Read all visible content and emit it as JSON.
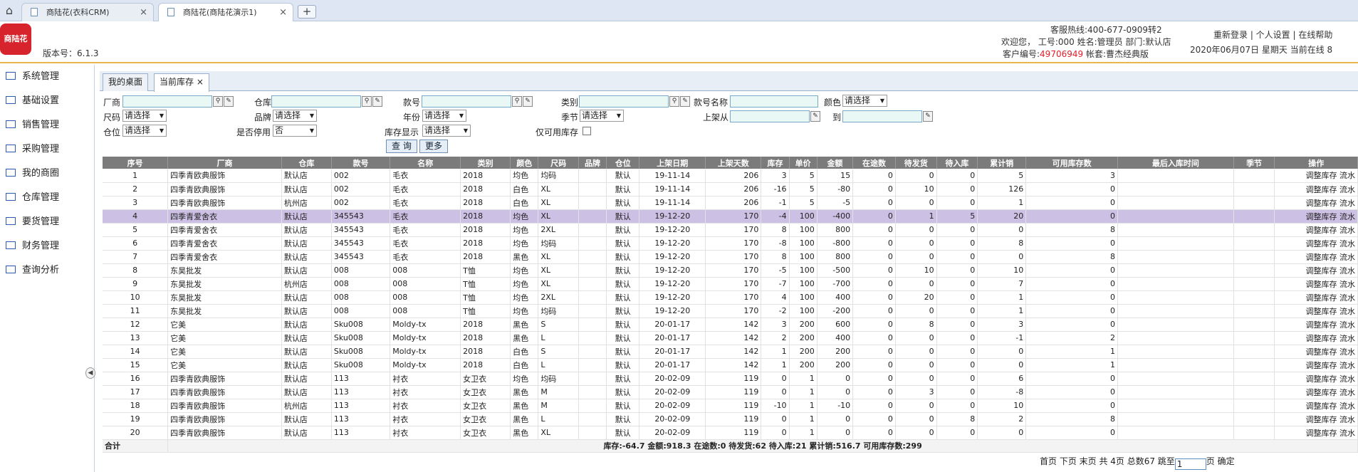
{
  "browser": {
    "tabs": [
      {
        "title": "商陆花(衣科CRM)",
        "close": "×"
      },
      {
        "title": "商陆花(商陆花演示1)",
        "close": "×"
      }
    ],
    "new_tab": "+",
    "home_icon": "⌂"
  },
  "header": {
    "logo_text": "商陆花",
    "version": "版本号：6.1.3",
    "hotline": "客服热线:400-677-0909转2",
    "welcome": "欢迎您，  工号:000 姓名:管理员 部门:默认店",
    "customer_label": "客户编号:",
    "customer_no": "49706949",
    "account": " 帐套:曹杰经典版",
    "links": "重新登录 | 个人设置 | 在线帮助",
    "date": "2020年06月07日 星期天 当前在线 8"
  },
  "sidebar": {
    "items": [
      "系统管理",
      "基础设置",
      "销售管理",
      "采购管理",
      "我的商圈",
      "仓库管理",
      "要货管理",
      "财务管理",
      "查询分析"
    ]
  },
  "page_tabs": [
    {
      "label": "我的桌面"
    },
    {
      "label": "当前库存",
      "close": "×"
    }
  ],
  "filters": {
    "vendor": "厂商",
    "warehouse": "仓库",
    "style_no": "款号",
    "category": "类别",
    "style_name": "款号名称",
    "color": "颜色",
    "size": "尺码",
    "brand": "品牌",
    "year": "年份",
    "season": "季节",
    "shelf_from": "上架从",
    "to": "到",
    "location": "仓位",
    "disabled": "是否停用",
    "stock_display": "库存显示",
    "available_only": "仅可用库存",
    "select_placeholder": "请选择",
    "disabled_value": "否",
    "query_button": "查 询",
    "more_button": "更多"
  },
  "table": {
    "columns": [
      "序号",
      "厂商",
      "仓库",
      "款号",
      "名称",
      "类别",
      "颜色",
      "尺码",
      "品牌",
      "仓位",
      "上架日期",
      "上架天数",
      "库存",
      "单价",
      "金额",
      "在途数",
      "待发货",
      "待入库",
      "累计销",
      "可用库存数",
      "最后入库时间",
      "季节",
      "操作"
    ],
    "rows": [
      [
        "1",
        "四季青欧典服饰",
        "默认店",
        "002",
        "毛衣",
        "2018",
        "均色",
        "均码",
        "",
        "默认",
        "19-11-14",
        "206",
        "3",
        "5",
        "15",
        "0",
        "0",
        "0",
        "5",
        "3",
        "",
        "",
        "调整库存 流水"
      ],
      [
        "2",
        "四季青欧典服饰",
        "默认店",
        "002",
        "毛衣",
        "2018",
        "白色",
        "XL",
        "",
        "默认",
        "19-11-14",
        "206",
        "-16",
        "5",
        "-80",
        "0",
        "10",
        "0",
        "126",
        "0",
        "",
        "",
        "调整库存 流水"
      ],
      [
        "3",
        "四季青欧典服饰",
        "杭州店",
        "002",
        "毛衣",
        "2018",
        "白色",
        "XL",
        "",
        "默认",
        "19-11-14",
        "206",
        "-1",
        "5",
        "-5",
        "0",
        "0",
        "0",
        "1",
        "0",
        "",
        "",
        "调整库存 流水"
      ],
      [
        "4",
        "四季青爱舍衣",
        "默认店",
        "345543",
        "毛衣",
        "2018",
        "均色",
        "XL",
        "",
        "默认",
        "19-12-20",
        "170",
        "-4",
        "100",
        "-400",
        "0",
        "1",
        "5",
        "20",
        "0",
        "",
        "",
        "调整库存 流水"
      ],
      [
        "5",
        "四季青爱舍衣",
        "默认店",
        "345543",
        "毛衣",
        "2018",
        "均色",
        "2XL",
        "",
        "默认",
        "19-12-20",
        "170",
        "8",
        "100",
        "800",
        "0",
        "0",
        "0",
        "0",
        "8",
        "",
        "",
        "调整库存 流水"
      ],
      [
        "6",
        "四季青爱舍衣",
        "默认店",
        "345543",
        "毛衣",
        "2018",
        "均色",
        "均码",
        "",
        "默认",
        "19-12-20",
        "170",
        "-8",
        "100",
        "-800",
        "0",
        "0",
        "0",
        "8",
        "0",
        "",
        "",
        "调整库存 流水"
      ],
      [
        "7",
        "四季青爱舍衣",
        "默认店",
        "345543",
        "毛衣",
        "2018",
        "黑色",
        "XL",
        "",
        "默认",
        "19-12-20",
        "170",
        "8",
        "100",
        "800",
        "0",
        "0",
        "0",
        "0",
        "8",
        "",
        "",
        "调整库存 流水"
      ],
      [
        "8",
        "东昊批发",
        "默认店",
        "008",
        "008",
        "T恤",
        "均色",
        "XL",
        "",
        "默认",
        "19-12-20",
        "170",
        "-5",
        "100",
        "-500",
        "0",
        "10",
        "0",
        "10",
        "0",
        "",
        "",
        "调整库存 流水"
      ],
      [
        "9",
        "东昊批发",
        "杭州店",
        "008",
        "008",
        "T恤",
        "均色",
        "XL",
        "",
        "默认",
        "19-12-20",
        "170",
        "-7",
        "100",
        "-700",
        "0",
        "0",
        "0",
        "7",
        "0",
        "",
        "",
        "调整库存 流水"
      ],
      [
        "10",
        "东昊批发",
        "默认店",
        "008",
        "008",
        "T恤",
        "均色",
        "2XL",
        "",
        "默认",
        "19-12-20",
        "170",
        "4",
        "100",
        "400",
        "0",
        "20",
        "0",
        "1",
        "0",
        "",
        "",
        "调整库存 流水"
      ],
      [
        "11",
        "东昊批发",
        "默认店",
        "008",
        "008",
        "T恤",
        "均色",
        "均码",
        "",
        "默认",
        "19-12-20",
        "170",
        "-2",
        "100",
        "-200",
        "0",
        "0",
        "0",
        "1",
        "0",
        "",
        "",
        "调整库存 流水"
      ],
      [
        "12",
        "它美",
        "默认店",
        "Sku008",
        "Moldy-tx",
        "2018",
        "黑色",
        "S",
        "",
        "默认",
        "20-01-17",
        "142",
        "3",
        "200",
        "600",
        "0",
        "8",
        "0",
        "3",
        "0",
        "",
        "",
        "调整库存 流水"
      ],
      [
        "13",
        "它美",
        "默认店",
        "Sku008",
        "Moldy-tx",
        "2018",
        "黑色",
        "L",
        "",
        "默认",
        "20-01-17",
        "142",
        "2",
        "200",
        "400",
        "0",
        "0",
        "0",
        "-1",
        "2",
        "",
        "",
        "调整库存 流水"
      ],
      [
        "14",
        "它美",
        "默认店",
        "Sku008",
        "Moldy-tx",
        "2018",
        "白色",
        "S",
        "",
        "默认",
        "20-01-17",
        "142",
        "1",
        "200",
        "200",
        "0",
        "0",
        "0",
        "0",
        "1",
        "",
        "",
        "调整库存 流水"
      ],
      [
        "15",
        "它美",
        "默认店",
        "Sku008",
        "Moldy-tx",
        "2018",
        "白色",
        "L",
        "",
        "默认",
        "20-01-17",
        "142",
        "1",
        "200",
        "200",
        "0",
        "0",
        "0",
        "0",
        "1",
        "",
        "",
        "调整库存 流水"
      ],
      [
        "16",
        "四季青欧典服饰",
        "默认店",
        "113",
        "衬衣",
        "女卫衣",
        "均色",
        "均码",
        "",
        "默认",
        "20-02-09",
        "119",
        "0",
        "1",
        "0",
        "0",
        "0",
        "0",
        "6",
        "0",
        "",
        "",
        "调整库存 流水"
      ],
      [
        "17",
        "四季青欧典服饰",
        "默认店",
        "113",
        "衬衣",
        "女卫衣",
        "黑色",
        "M",
        "",
        "默认",
        "20-02-09",
        "119",
        "0",
        "1",
        "0",
        "0",
        "3",
        "0",
        "-8",
        "0",
        "",
        "",
        "调整库存 流水"
      ],
      [
        "18",
        "四季青欧典服饰",
        "杭州店",
        "113",
        "衬衣",
        "女卫衣",
        "黑色",
        "M",
        "",
        "默认",
        "20-02-09",
        "119",
        "-10",
        "1",
        "-10",
        "0",
        "0",
        "0",
        "10",
        "0",
        "",
        "",
        "调整库存 流水"
      ],
      [
        "19",
        "四季青欧典服饰",
        "默认店",
        "113",
        "衬衣",
        "女卫衣",
        "黑色",
        "L",
        "",
        "默认",
        "20-02-09",
        "119",
        "0",
        "1",
        "0",
        "0",
        "0",
        "8",
        "2",
        "8",
        "",
        "",
        "调整库存 流水"
      ],
      [
        "20",
        "四季青欧典服饰",
        "默认店",
        "113",
        "衬衣",
        "女卫衣",
        "黑色",
        "XL",
        "",
        "默认",
        "20-02-09",
        "119",
        "0",
        "1",
        "0",
        "0",
        "0",
        "0",
        "0",
        "0",
        "",
        "",
        "调整库存 流水"
      ]
    ],
    "highlight_row": 3,
    "summary_label": "合计",
    "summary": "库存:-64.7 金额:918.3 在途数:0 待发货:62 待入库:21 累计销:516.7 可用库存数:299"
  },
  "pager": {
    "text": "首页 下页 末页 共 4页 总数67 跳至",
    "page": "1",
    "suffix": "页 确定"
  },
  "colors": {
    "accent": "#d7242c",
    "header_border": "#e9b64d",
    "table_header": "#7b7b7b",
    "highlight": "#ccc0e4",
    "customer_no": "#e0202a"
  }
}
